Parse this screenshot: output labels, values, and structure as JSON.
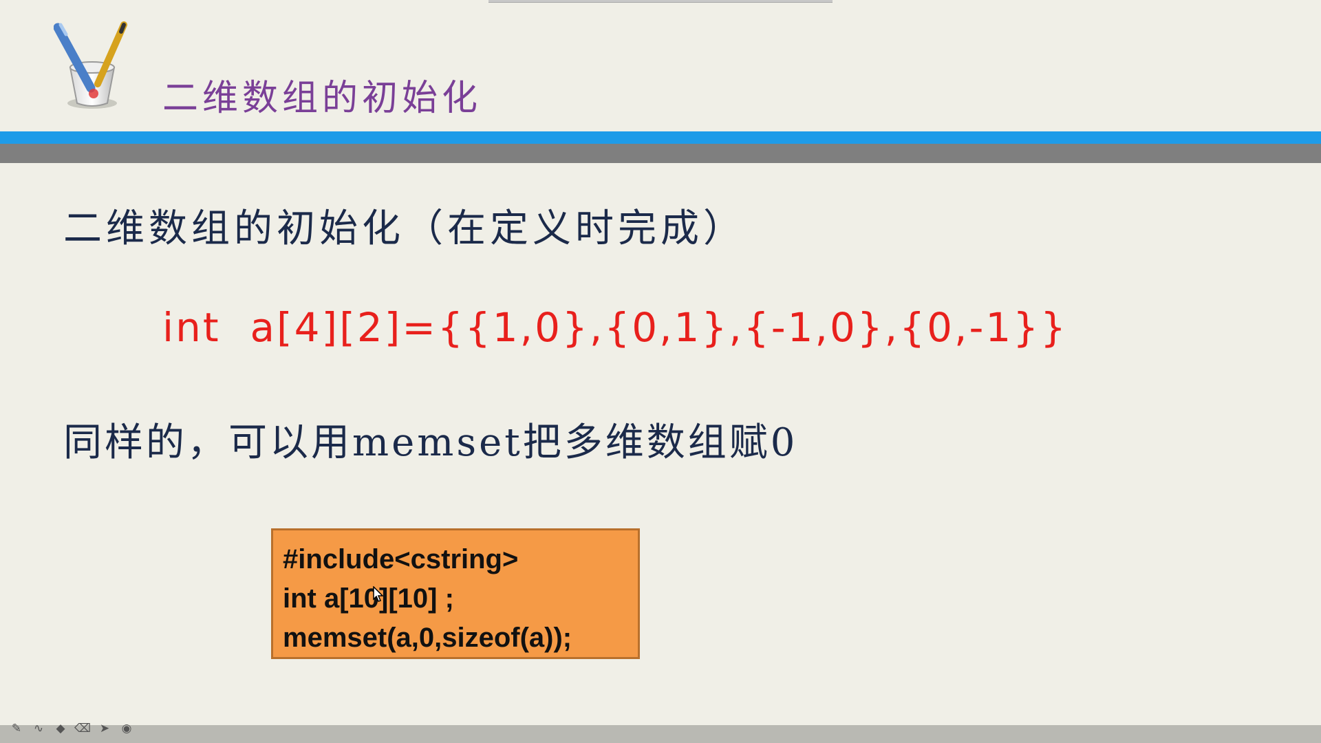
{
  "slide": {
    "title": "二维数组的初始化",
    "heading": "二维数组的初始化（在定义时完成）",
    "code_example": "int  a[4][2]={{1,0},{0,1},{-1,0},{0,-1}}",
    "memset_text": "同样的，可以用memset把多维数组赋0"
  },
  "code_box": {
    "lines": [
      "#include<cstring>",
      "int a[10][10] ;",
      "memset(a,0,sizeof(a));"
    ]
  },
  "toolbar": {
    "items": [
      {
        "icon": "pen-icon",
        "glyph": "✎"
      },
      {
        "icon": "curve-icon",
        "glyph": "∿"
      },
      {
        "icon": "marker-icon",
        "glyph": "◆"
      },
      {
        "icon": "eraser-icon",
        "glyph": "⌫"
      },
      {
        "icon": "pointer-icon",
        "glyph": "➤"
      },
      {
        "icon": "target-icon",
        "glyph": "◉"
      }
    ]
  },
  "colors": {
    "title": "#7a3f97",
    "accent_bar": "#1e9be8",
    "code_red": "#e8201c",
    "box_orange": "#f59a46"
  }
}
